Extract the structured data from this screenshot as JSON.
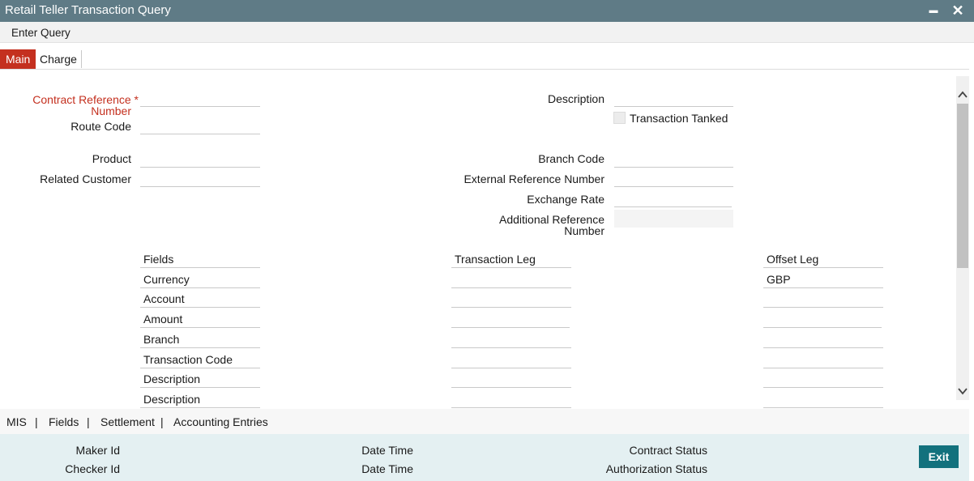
{
  "window": {
    "title": "Retail Teller Transaction Query",
    "minimize_glyph": "▬",
    "close_glyph": "✕"
  },
  "menu": {
    "enter_query": "Enter Query"
  },
  "tabs": [
    {
      "label": "Main"
    },
    {
      "label": "Charge"
    }
  ],
  "form": {
    "contract_reference_label_1": "Contract Reference *",
    "contract_reference_label_2": "Number",
    "route_code_label": "Route Code",
    "product_label": "Product",
    "related_customer_label": "Related Customer",
    "description_label": "Description",
    "transaction_tanked_label": "Transaction Tanked",
    "branch_code_label": "Branch Code",
    "external_reference_label": "External Reference Number",
    "exchange_rate_label": "Exchange Rate",
    "additional_reference_label_1": "Additional Reference",
    "additional_reference_label_2": "Number",
    "contract_reference": "",
    "route_code": "",
    "product": "",
    "related_customer": "",
    "description": "",
    "branch_code": "",
    "external_reference": "",
    "exchange_rate": "",
    "additional_reference": ""
  },
  "grid": {
    "headers": {
      "fields": "Fields",
      "transaction_leg": "Transaction Leg",
      "offset_leg": "Offset Leg"
    },
    "rows": [
      {
        "field": "Currency",
        "transaction_leg": "",
        "offset_leg": "GBP"
      },
      {
        "field": "Account",
        "transaction_leg": "",
        "offset_leg": ""
      },
      {
        "field": "Amount",
        "transaction_leg": "",
        "offset_leg": ""
      },
      {
        "field": "Branch",
        "transaction_leg": "",
        "offset_leg": ""
      },
      {
        "field": "Transaction Code",
        "transaction_leg": "",
        "offset_leg": ""
      },
      {
        "field": "Description",
        "transaction_leg": "",
        "offset_leg": ""
      },
      {
        "field": "Description",
        "transaction_leg": "",
        "offset_leg": ""
      }
    ]
  },
  "subtabs": {
    "mis": "MIS",
    "fields": "Fields",
    "settlement": "Settlement",
    "accounting_entries": "Accounting Entries",
    "separator": "|"
  },
  "footer": {
    "maker_id": "Maker Id",
    "checker_id": "Checker Id",
    "date_time_1": "Date Time",
    "date_time_2": "Date Time",
    "contract_status": "Contract Status",
    "authorization_status": "Authorization Status",
    "exit": "Exit"
  },
  "icons": {
    "scroll_up": "chevron-up-icon",
    "scroll_down": "chevron-down-icon"
  },
  "colors": {
    "titlebar": "#5f7b86",
    "active_tab": "#c4301f",
    "required_label": "#c4301f",
    "exit_button": "#12717d",
    "footer_bg": "#e4f0f2"
  }
}
